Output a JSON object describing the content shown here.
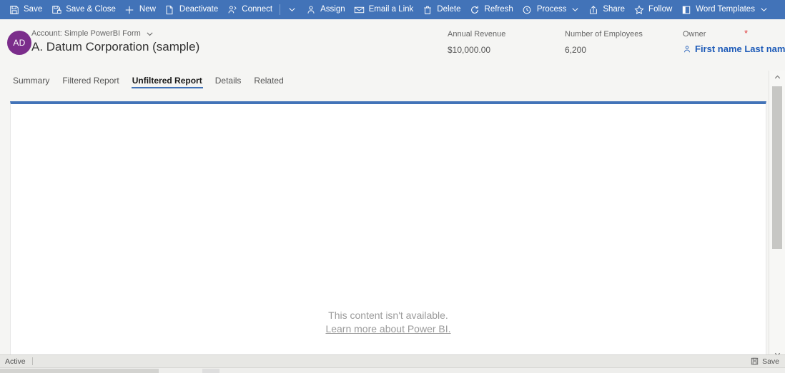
{
  "command_bar": {
    "items": [
      {
        "icon": "save-icon",
        "label": "Save",
        "caret": false
      },
      {
        "icon": "save-close-icon",
        "label": "Save & Close",
        "caret": false
      },
      {
        "icon": "plus-icon",
        "label": "New",
        "caret": false
      },
      {
        "icon": "deactivate-icon",
        "label": "Deactivate",
        "caret": false
      },
      {
        "icon": "connect-icon",
        "label": "Connect",
        "caret": false
      },
      {
        "icon": "assign-icon",
        "label": "Assign",
        "caret": false
      },
      {
        "icon": "email-link-icon",
        "label": "Email a Link",
        "caret": false
      },
      {
        "icon": "delete-icon",
        "label": "Delete",
        "caret": false
      },
      {
        "icon": "refresh-icon",
        "label": "Refresh",
        "caret": false
      },
      {
        "icon": "process-icon",
        "label": "Process",
        "caret": true
      },
      {
        "icon": "share-icon",
        "label": "Share",
        "caret": false
      },
      {
        "icon": "follow-star-icon",
        "label": "Follow",
        "caret": false
      },
      {
        "icon": "word-templates-icon",
        "label": "Word Templates",
        "caret": true
      }
    ],
    "overflow_caret_after": 4
  },
  "header": {
    "avatar_initials": "AD",
    "form_label": "Account: Simple PowerBI Form",
    "record_title": "A. Datum Corporation (sample)",
    "fields": [
      {
        "label": "Annual Revenue",
        "value": "$10,000.00",
        "required": false
      },
      {
        "label": "Number of Employees",
        "value": "6,200",
        "required": false
      },
      {
        "label": "Owner",
        "value": "First name Last name",
        "required": true
      }
    ]
  },
  "tabs": [
    {
      "label": "Summary",
      "active": false
    },
    {
      "label": "Filtered Report",
      "active": false
    },
    {
      "label": "Unfiltered Report",
      "active": true
    },
    {
      "label": "Details",
      "active": false
    },
    {
      "label": "Related",
      "active": false
    }
  ],
  "report": {
    "empty_message": "This content isn't available.",
    "learn_more_link": "Learn more about Power BI."
  },
  "status_bar": {
    "state": "Active",
    "save_label": "Save"
  },
  "colors": {
    "command_bar": "#4273b8",
    "accent": "#4273b8",
    "avatar": "#7b2d8b",
    "link": "#1e5bb8",
    "required": "#e03e3e",
    "page_background": "#f5f5f3"
  }
}
